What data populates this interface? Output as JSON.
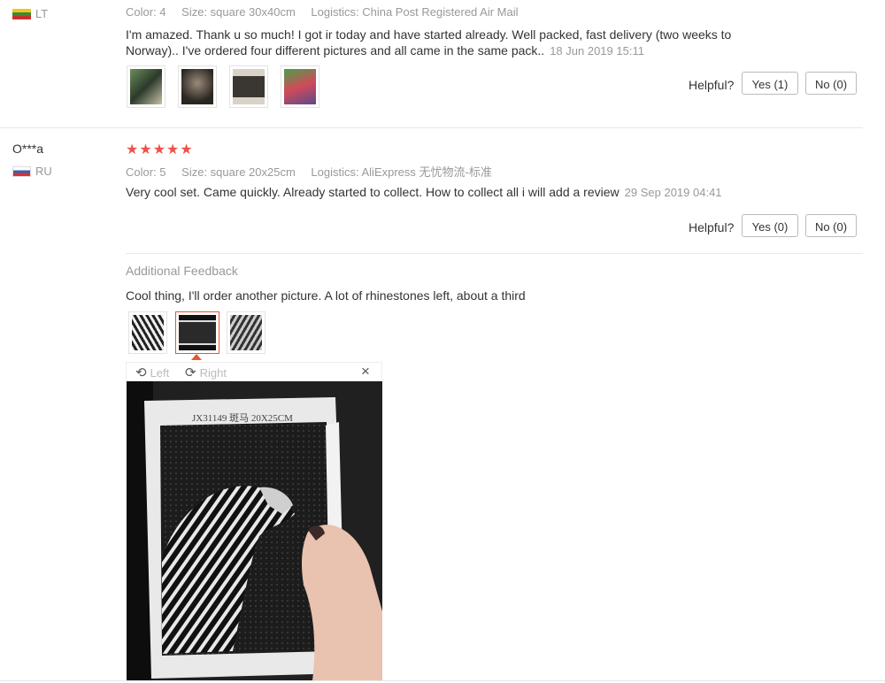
{
  "review1": {
    "country": "LT",
    "meta": {
      "color": "Color: 4",
      "size": "Size: square 30x40cm",
      "logistics": "Logistics: China Post Registered Air Mail"
    },
    "text_line1": "I'm amazed. Thank u so much! I got ir today and have started already. Well packed, fast delivery (two weeks to",
    "text_line2": "Norway).. I've ordered four different pictures and all came in the same pack..",
    "date": "18 Jun 2019 15:11",
    "helpful_label": "Helpful?",
    "yes_label": "Yes (1)",
    "no_label": "No (0)"
  },
  "review2": {
    "user": "O***a",
    "country": "RU",
    "stars": "★★★★★",
    "meta": {
      "color": "Color: 5",
      "size": "Size: square 20x25cm",
      "logistics": "Logistics: AliExpress 无忧物流-标准"
    },
    "text": "Very cool set. Came quickly. Already started to collect. How to collect all i will add a review",
    "date": "29 Sep 2019 04:41",
    "helpful_label": "Helpful?",
    "yes_label": "Yes (0)",
    "no_label": "No (0)",
    "additional": {
      "heading": "Additional Feedback",
      "text": "Cool thing, I'll order another picture. A lot of rhinestones left, about a third"
    },
    "viewer": {
      "left_label": "Left",
      "right_label": "Right",
      "close": "×",
      "canvas_label": "JX31149 斑马 20X25CM"
    }
  },
  "icons": {
    "rotate_left": "rotate-left-icon",
    "rotate_right": "rotate-right-icon",
    "close": "close-icon"
  },
  "colors": {
    "star": "#f0514a",
    "active_thumb": "#e4572e"
  }
}
